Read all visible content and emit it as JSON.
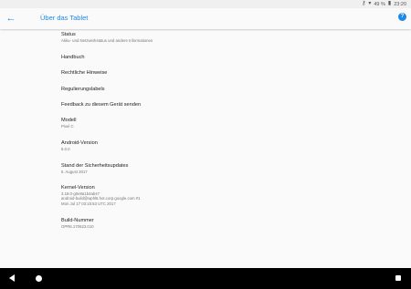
{
  "status_bar": {
    "key_icon": "key-icon",
    "wifi_icon": "wifi-icon",
    "battery_percent": "49 %",
    "battery_icon": "battery-icon",
    "time": "23:20"
  },
  "app_bar": {
    "back_icon": "arrow-back-icon",
    "title": "Über das Tablet",
    "help_icon": "help-icon",
    "accent_color": "#1e88e5"
  },
  "items": [
    {
      "title": "Status",
      "subtitle": "Akku- und Netzwerkstatus und andere Informationen"
    },
    {
      "title": "Handbuch"
    },
    {
      "title": "Rechtliche Hinweise"
    },
    {
      "title": "Regulierungslabels"
    },
    {
      "title": "Feedback zu diesem Gerät senden"
    },
    {
      "title": "Modell",
      "subtitle": "Pixel C"
    },
    {
      "title": "Android-Version",
      "subtitle": "8.0.0"
    },
    {
      "title": "Stand der Sicherheitsupdates",
      "subtitle": "5. August 2017"
    },
    {
      "title": "Kernel-Version",
      "subtitle_lines": [
        "3.18.0-g0e8a1b4ab47",
        "android-build@wphl5.hot.corp.google.com #1",
        "Mon Jul 17 03:15:53 UTC 2017"
      ]
    },
    {
      "title": "Build-Nummer",
      "subtitle": "OPR6.170623.010"
    }
  ],
  "nav_bar": {
    "back_icon": "nav-back-icon",
    "home_icon": "nav-home-icon",
    "recents_icon": "nav-recents-icon"
  }
}
